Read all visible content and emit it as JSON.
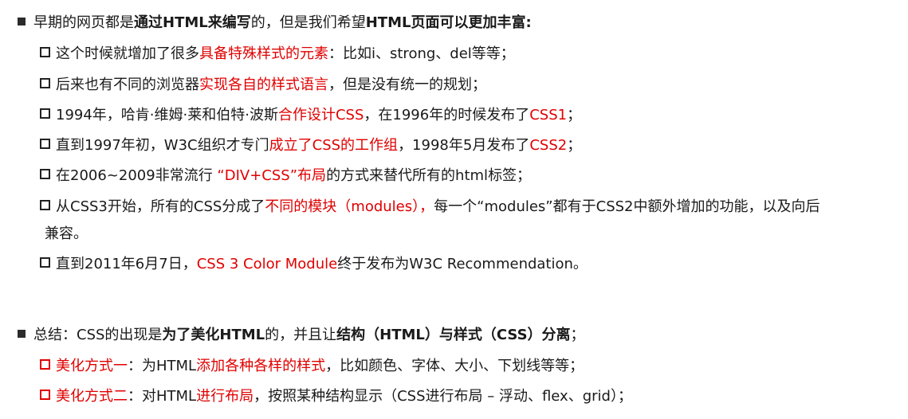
{
  "section1": {
    "heading": {
      "t1": "早期的网页都是",
      "t2": "通过HTML来编写",
      "t3": "的，但是我们希望",
      "t4": "HTML页面可以更加丰富:"
    },
    "items": [
      {
        "a": "这个时候就增加了很多",
        "b": "具备特殊样式的元素",
        "c": "：比如i、strong、del等等；"
      },
      {
        "a": "后来也有不同的浏览器",
        "b": "实现各自的样式语言",
        "c": "，但是没有统一的规划；"
      },
      {
        "a": "1994年，哈肯·维姆·莱和伯特·波斯",
        "b": "合作设计CSS",
        "c": "，在1996年的时候发布了",
        "d": "CSS1",
        "e": "；"
      },
      {
        "a": "直到1997年初，W3C组织才专门",
        "b": "成立了CSS的工作组",
        "c": "，1998年5月发布了",
        "d": "CSS2",
        "e": "；"
      },
      {
        "a": "在2006~2009非常流行 ",
        "b": "“DIV+CSS”布局",
        "c": "的方式来替代所有的html标签；"
      },
      {
        "a": "从CSS3开始，所有的CSS分成了",
        "b": "不同的模块（modules），",
        "c": "每一个“modules”都有于CSS2中额外增加的功能，以及向后",
        "d": "兼容。"
      },
      {
        "a": "直到2011年6月7日，",
        "b": "CSS 3 Color Module",
        "c": "终于发布为W3C Recommendation。"
      }
    ]
  },
  "section2": {
    "heading": {
      "t1": "总结：CSS的出现是",
      "t2": "为了美化HTML",
      "t3": "的，并且让",
      "t4": "结构（HTML）与样式（CSS）分离",
      "t5": "；"
    },
    "items": [
      {
        "a": "美化方式一",
        "b": "：为HTML",
        "c": "添加各种各样的样式",
        "d": "，比如颜色、字体、大小、下划线等等；"
      },
      {
        "a": "美化方式二",
        "b": "：对HTML",
        "c": "进行布局",
        "d": "，按照某种结构显示（CSS进行布局 – 浮动、flex、grid）；"
      }
    ]
  },
  "colors": {
    "accent_red": "#e00000",
    "text": "#1a1a1a"
  }
}
